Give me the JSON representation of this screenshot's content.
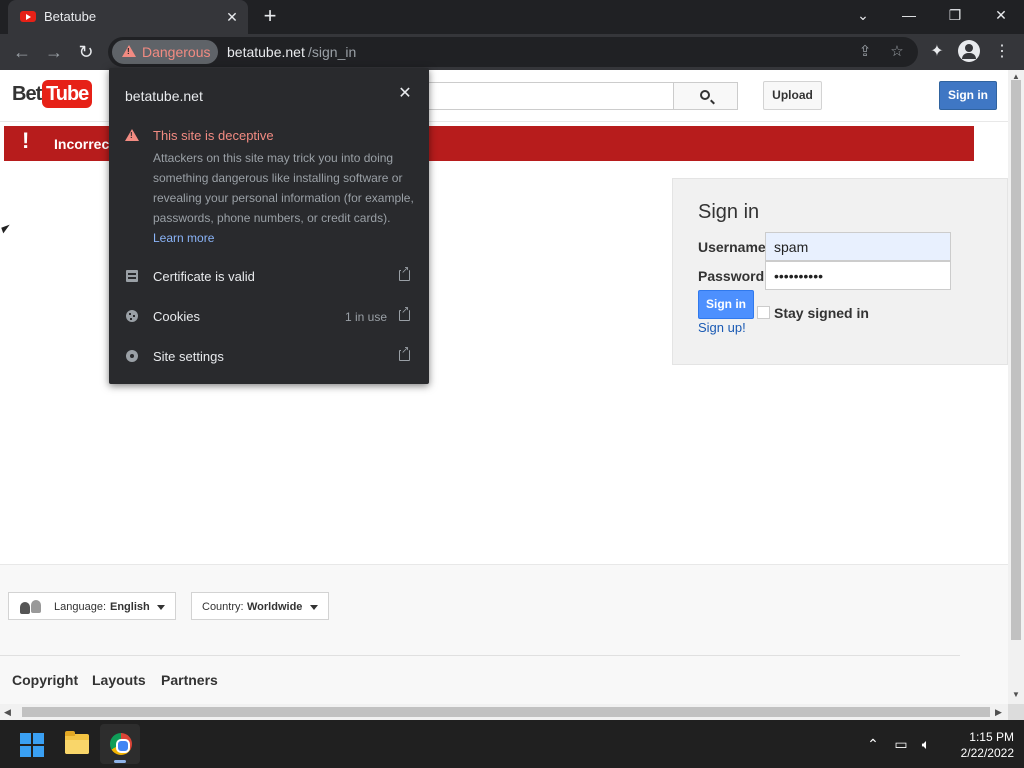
{
  "browser": {
    "tab": {
      "title": "Betatube"
    },
    "window_controls": {
      "tab_search": "⌄",
      "minimize": "—",
      "restore": "❐",
      "close": "✕"
    },
    "address": {
      "security_label": "Dangerous",
      "host": "betatube.net",
      "path": "/sign_in"
    }
  },
  "site_info_popup": {
    "host": "betatube.net",
    "warning_title": "This site is deceptive",
    "warning_body": "Attackers on this site may trick you into doing something dangerous like installing software or revealing your personal information (for example, passwords, phone numbers, or credit cards).",
    "learn_more": "Learn more",
    "rows": [
      {
        "label": "Certificate is valid",
        "meta": ""
      },
      {
        "label": "Cookies",
        "meta": "1 in use"
      },
      {
        "label": "Site settings",
        "meta": ""
      }
    ]
  },
  "page": {
    "logo": {
      "part1": "Beta",
      "part2": "Tube"
    },
    "header": {
      "upload": "Upload",
      "sign_in": "Sign in"
    },
    "alert": {
      "text": "Incorrect"
    },
    "signin": {
      "title": "Sign in",
      "username_label": "Username",
      "username_value": "spam",
      "password_label": "Password",
      "password_value": "••••••••••",
      "button": "Sign in",
      "stay_signed_in": "Stay signed in",
      "signup": "Sign up!"
    },
    "footer": {
      "language_label": "Language:",
      "language_value": "English",
      "country_label": "Country:",
      "country_value": "Worldwide",
      "links": [
        "Copyright",
        "Layouts",
        "Partners"
      ]
    }
  },
  "taskbar": {
    "time": "1:15 PM",
    "date": "2/22/2022"
  },
  "colors": {
    "danger": "#f28b82",
    "alert_bg": "#b71c1c",
    "brand_red": "#e62117",
    "signin_blue": "#4d90fe"
  }
}
